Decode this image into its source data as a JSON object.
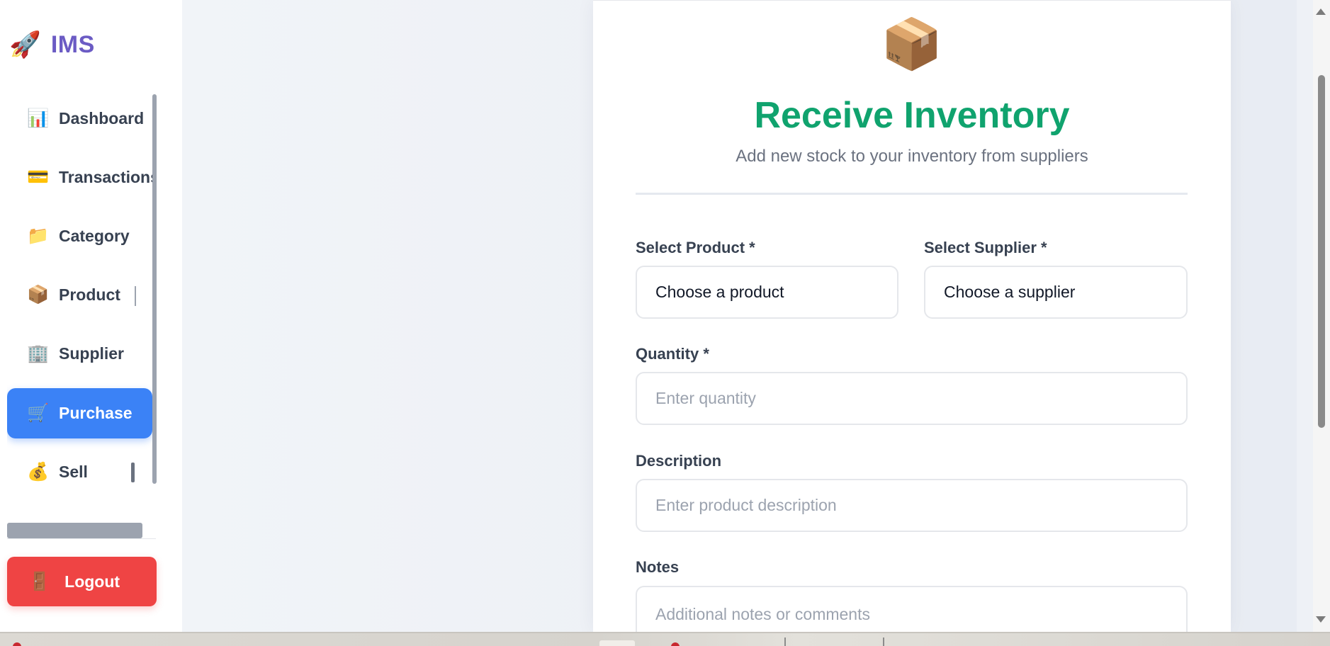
{
  "brand": {
    "icon": "🚀",
    "name": "IMS"
  },
  "sidebar": {
    "items": [
      {
        "icon": "📊",
        "icon_name": "bar-chart-icon",
        "label": "Dashboard",
        "active": false
      },
      {
        "icon": "💳",
        "icon_name": "credit-card-icon",
        "label": "Transactions",
        "active": false
      },
      {
        "icon": "📁",
        "icon_name": "folder-icon",
        "label": "Category",
        "active": false
      },
      {
        "icon": "📦",
        "icon_name": "package-icon",
        "label": "Product",
        "active": false
      },
      {
        "icon": "🏢",
        "icon_name": "building-icon",
        "label": "Supplier",
        "active": false
      },
      {
        "icon": "🛒",
        "icon_name": "shopping-cart-icon",
        "label": "Purchase",
        "active": true
      },
      {
        "icon": "💰",
        "icon_name": "money-bag-icon",
        "label": "Sell",
        "active": false
      }
    ],
    "logout": {
      "icon": "🚪",
      "icon_name": "door-icon",
      "label": "Logout"
    }
  },
  "form": {
    "icon": "📦",
    "title": "Receive Inventory",
    "subtitle": "Add new stock to your inventory from suppliers",
    "product": {
      "label": "Select Product *",
      "value": "Choose a product"
    },
    "supplier": {
      "label": "Select Supplier *",
      "value": "Choose a supplier"
    },
    "quantity": {
      "label": "Quantity *",
      "placeholder": "Enter quantity"
    },
    "description": {
      "label": "Description",
      "placeholder": "Enter product description"
    },
    "notes": {
      "label": "Notes",
      "placeholder": "Additional notes or comments"
    }
  },
  "colors": {
    "brand": "#6b5bc4",
    "title": "#10a36e",
    "active_nav": "#3b82f6",
    "logout": "#ef4444"
  }
}
